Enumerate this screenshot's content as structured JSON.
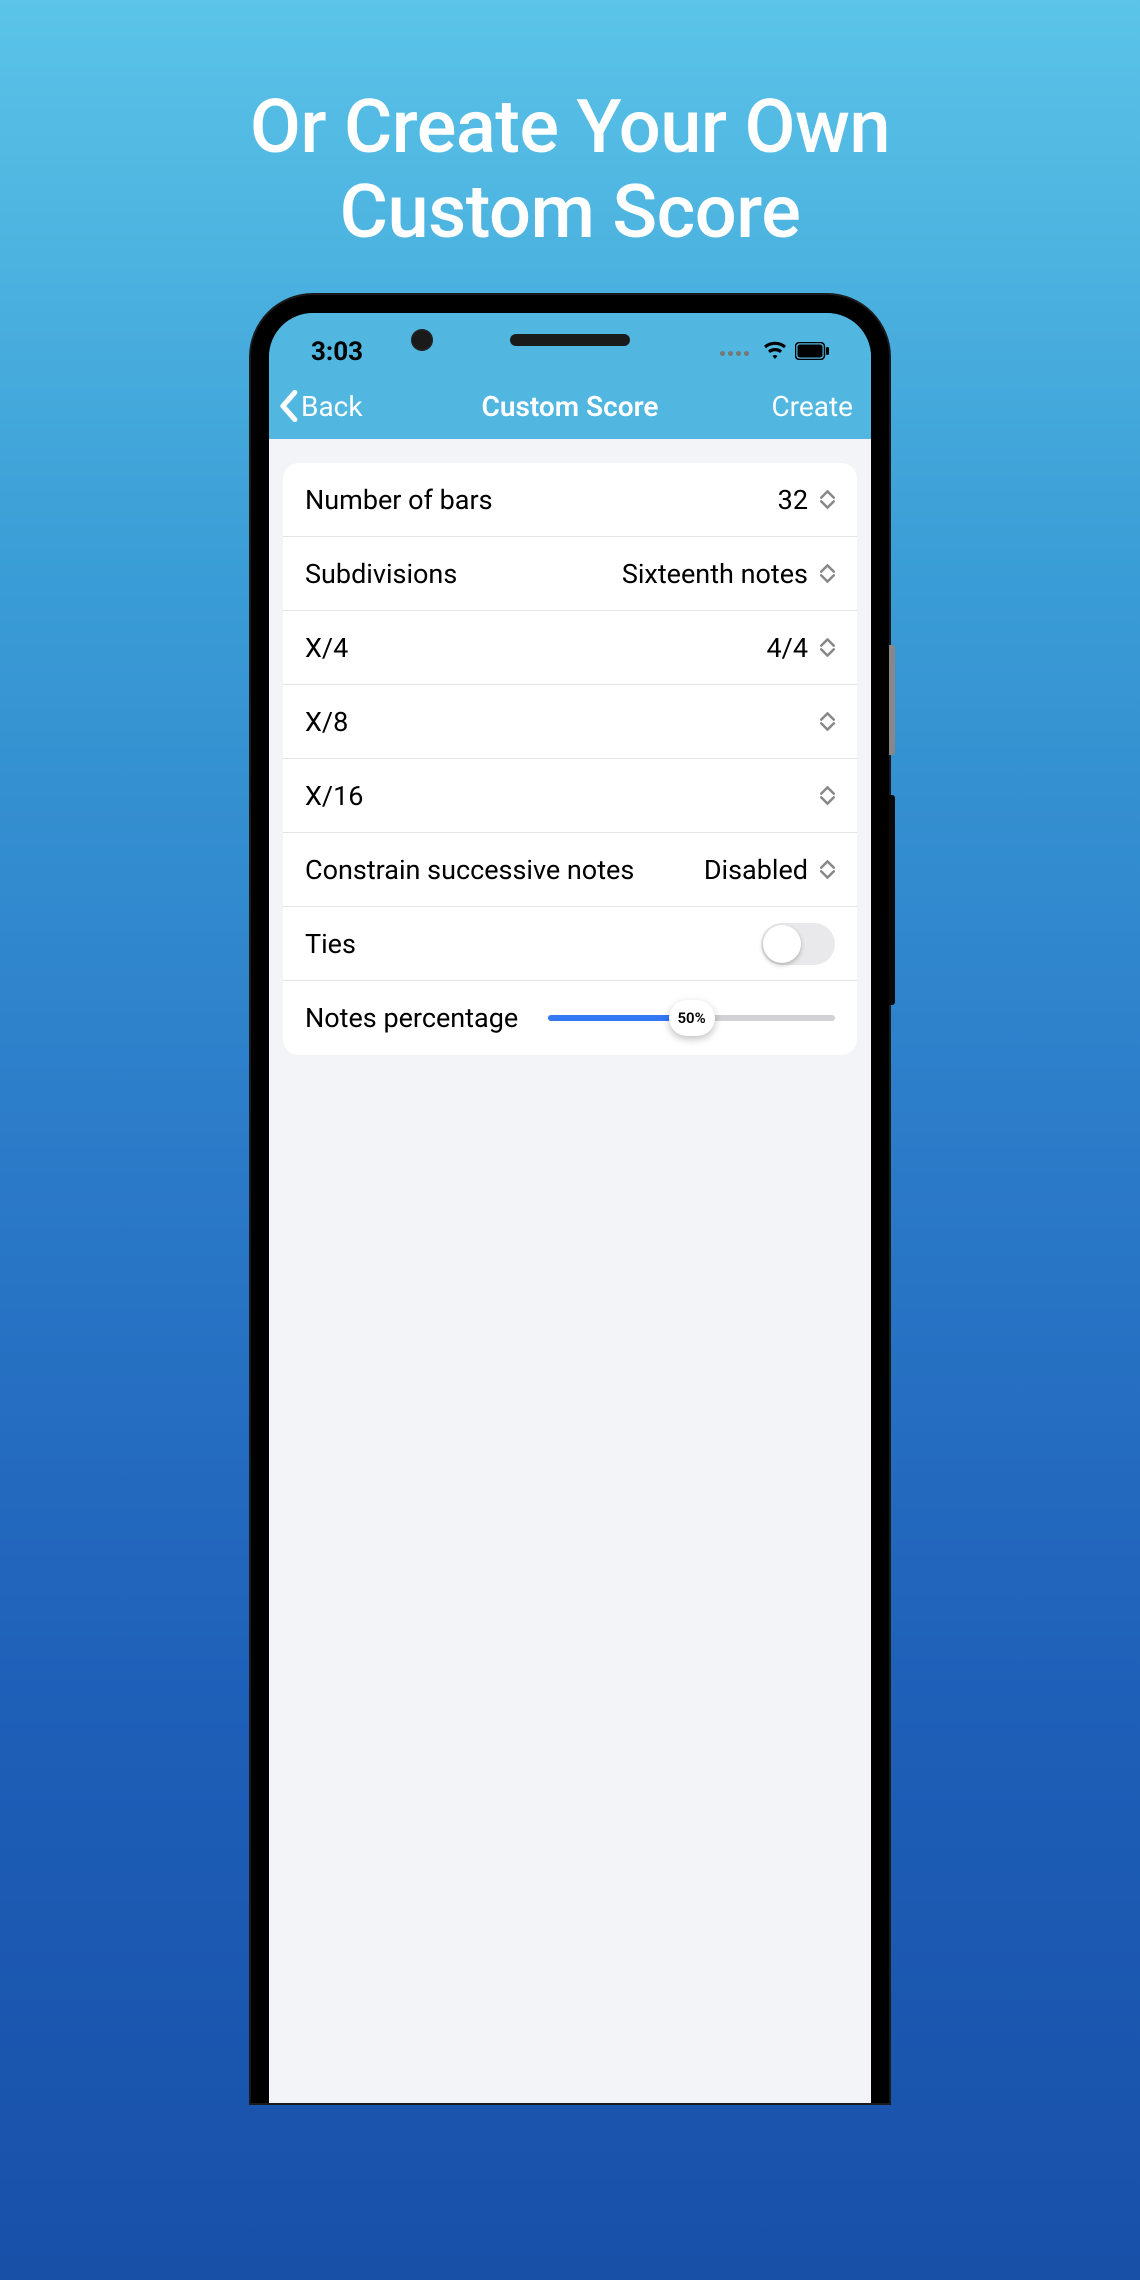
{
  "promo": {
    "line1": "Or Create Your Own",
    "line2": "Custom Score"
  },
  "status": {
    "time": "3:03"
  },
  "nav": {
    "back": "Back",
    "title": "Custom Score",
    "create": "Create"
  },
  "rows": {
    "bars": {
      "label": "Number of bars",
      "value": "32"
    },
    "subdivisions": {
      "label": "Subdivisions",
      "value": "Sixteenth notes"
    },
    "x4": {
      "label": "X/4",
      "value": "4/4"
    },
    "x8": {
      "label": "X/8",
      "value": ""
    },
    "x16": {
      "label": "X/16",
      "value": ""
    },
    "constrain": {
      "label": "Constrain successive notes",
      "value": "Disabled"
    },
    "ties": {
      "label": "Ties"
    },
    "notes_pct": {
      "label": "Notes percentage",
      "value": "50%"
    }
  }
}
